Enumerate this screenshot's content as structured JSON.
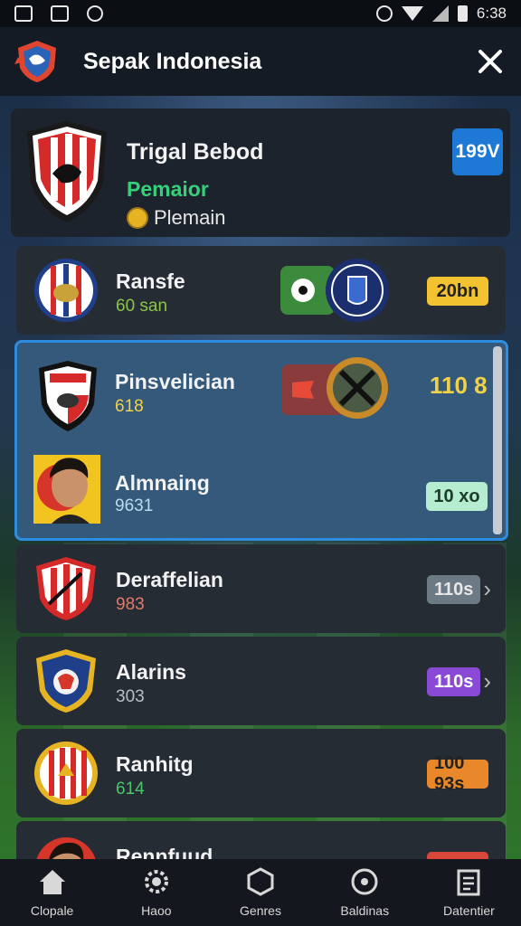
{
  "status_bar": {
    "time": "6:38"
  },
  "header": {
    "title": "Sepak Indonesia"
  },
  "top_card": {
    "name": "Trigal Bebod",
    "league": "Pemaior",
    "sub": "Plemain",
    "badge": "199V",
    "colors": {
      "league": "#37d07a",
      "badge": "#1e78d6"
    }
  },
  "rows": [
    {
      "name": "Ransfe",
      "value": "60 san",
      "pill": "20bn",
      "value_color": "#8bc34a",
      "pill_bg": "#f2c230",
      "pill_color": "#222",
      "icon": "crest-blue-red"
    },
    {
      "name": "Deraffelian",
      "value": "983",
      "pill": "110s",
      "value_color": "#e07a6a",
      "pill_bg": "#6c7a86",
      "pill_color": "#e8e8e8",
      "icon": "crest-red-white"
    },
    {
      "name": "Alarins",
      "value": "303",
      "pill": "110s",
      "value_color": "#b8bec6",
      "pill_bg": "#8a4ad6",
      "pill_color": "#fff",
      "icon": "crest-blue-yellow"
    },
    {
      "name": "Ranhitg",
      "value": "614",
      "pill": "100 93s",
      "value_color": "#4cc46a",
      "pill_bg": "#e8882a",
      "pill_color": "#222",
      "icon": "crest-red-yellow"
    },
    {
      "name": "Rennfuud",
      "value": "",
      "pill": "",
      "value_color": "#ccc",
      "pill_bg": "#d9473a",
      "pill_color": "#fff",
      "icon": "avatar"
    }
  ],
  "highlight": {
    "item1": {
      "name": "Pinsvelician",
      "value": "618",
      "score": "110 8"
    },
    "item2": {
      "name": "Almnaing",
      "value": "9631",
      "pill": "10 xo"
    }
  },
  "bottom_nav": [
    {
      "label": "Clopale",
      "icon": "home-icon"
    },
    {
      "label": "Haoo",
      "icon": "gear-icon"
    },
    {
      "label": "Genres",
      "icon": "hexagon-icon"
    },
    {
      "label": "Baldinas",
      "icon": "ball-icon"
    },
    {
      "label": "Datentier",
      "icon": "clipboard-icon"
    }
  ]
}
